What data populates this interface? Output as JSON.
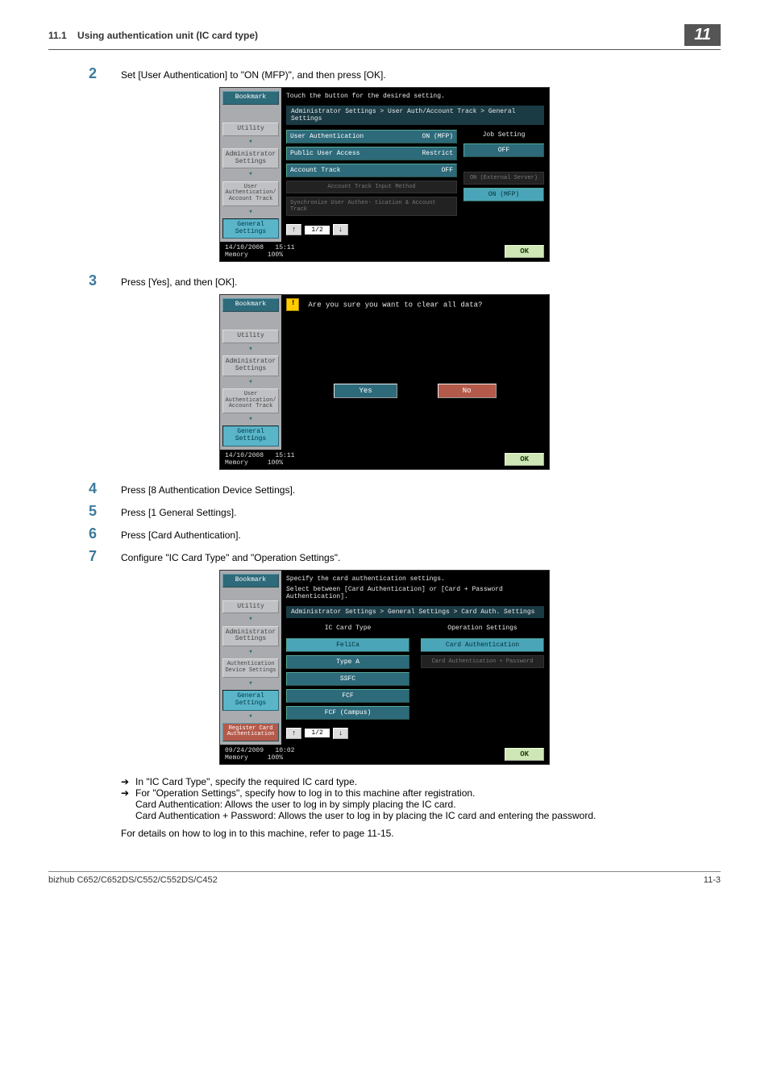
{
  "header": {
    "section_no": "11.1",
    "section_title": "Using authentication unit (IC card type)",
    "chapter_badge": "11"
  },
  "steps": {
    "s2": {
      "num": "2",
      "text": "Set [User Authentication] to \"ON (MFP)\", and then press [OK]."
    },
    "s3": {
      "num": "3",
      "text": "Press [Yes], and then [OK]."
    },
    "s4": {
      "num": "4",
      "text": "Press [8 Authentication Device Settings]."
    },
    "s5": {
      "num": "5",
      "text": "Press [1 General Settings]."
    },
    "s6": {
      "num": "6",
      "text": "Press [Card Authentication]."
    },
    "s7": {
      "num": "7",
      "text": "Configure \"IC Card Type\" and \"Operation Settings\"."
    }
  },
  "bullets": {
    "b1": "In \"IC Card Type\", specify the required IC card type.",
    "b2": "For \"Operation Settings\", specify how to log in to this machine after registration.",
    "b2a": "Card Authentication: Allows the user to log in by simply placing the IC card.",
    "b2b": "Card Authentication + Password: Allows the user to log in by placing the IC card and entering the password."
  },
  "ref_line": "For details on how to log in to this machine, refer to page 11-15.",
  "footer": {
    "model": "bizhub C652/C652DS/C552/C552DS/C452",
    "page": "11-3"
  },
  "screen1": {
    "instr": "Touch the button for the desired setting.",
    "crumb": "Administrator Settings > User Auth/Account Track  > General Settings",
    "side": {
      "bookmark": "Bookmark",
      "utility": "Utility",
      "admin": "Administrator Settings",
      "userauth": "User Authentication/ Account Track",
      "general": "General Settings"
    },
    "rows": {
      "r1_l": "User Authentication",
      "r1_v": "ON (MFP)",
      "r2_l": "Public User Access",
      "r2_v": "Restrict",
      "r3_l": "Account Track",
      "r3_v": "OFF",
      "r4_l": "Account Track Input Method",
      "r5_l": "Synchronize User Authen- tication & Account Track"
    },
    "right": {
      "title": "Job Setting",
      "off": "OFF",
      "ext": "ON (External Server)",
      "mfp": "ON (MFP)"
    },
    "pager": "1/2",
    "status_date": "14/10/2008",
    "status_time": "15:11",
    "status_mem_l": "Memory",
    "status_mem_v": "100%",
    "ok": "OK"
  },
  "screen2": {
    "prompt": "Are you sure you want to clear all data?",
    "side": {
      "bookmark": "Bookmark",
      "utility": "Utility",
      "admin": "Administrator Settings",
      "userauth": "User Authentication/ Account Track",
      "general": "General Settings"
    },
    "yes": "Yes",
    "no": "No",
    "status_date": "14/10/2008",
    "status_time": "15:11",
    "status_mem_l": "Memory",
    "status_mem_v": "100%",
    "ok": "OK"
  },
  "screen3": {
    "instr1": "Specify the card authentication settings.",
    "instr2": "Select between [Card Authentication] or [Card + Password Authentication].",
    "crumb": "Administrator Settings > General Settings > Card Auth. Settings",
    "side": {
      "bookmark": "Bookmark",
      "utility": "Utility",
      "admin": "Administrator Settings",
      "authdev": "Authentication Device Settings",
      "general": "General Settings",
      "register": "Register Card Authentication"
    },
    "col1_head": "IC Card Type",
    "col2_head": "Operation Settings",
    "col1": {
      "a": "FeliCa",
      "b": "Type A",
      "c": "SSFC",
      "d": "FCF",
      "e": "FCF (Campus)"
    },
    "col2": {
      "a": "Card Authentication",
      "b": "Card Authentication + Password"
    },
    "pager": "1/2",
    "status_date": "09/24/2009",
    "status_time": "10:02",
    "status_mem_l": "Memory",
    "status_mem_v": "100%",
    "ok": "OK"
  }
}
